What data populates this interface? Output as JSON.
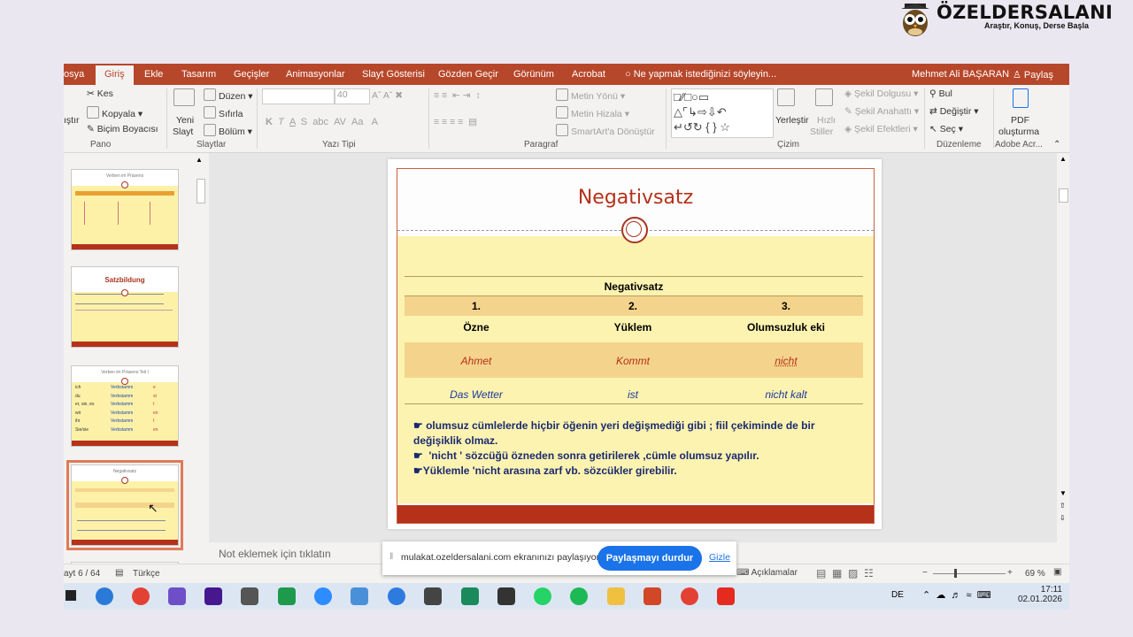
{
  "brand": {
    "name": "ÖZELDERSALANI",
    "tagline": "Araştır, Konuş, Derse Başla"
  },
  "tabs": {
    "dosya": "osya",
    "giris": "Giriş",
    "ekle": "Ekle",
    "tasarim": "Tasarım",
    "gecisler": "Geçişler",
    "animasyonlar": "Animasyonlar",
    "slayt": "Slayt Gösterisi",
    "gozden": "Gözden Geçir",
    "gorunum": "Görünüm",
    "acrobat": "Acrobat",
    "tell": "Ne yapmak istediğinizi söyleyin...",
    "user": "Mehmet Ali BAŞARAN",
    "share": "Paylaş"
  },
  "ribbon": {
    "paste": "ıştır",
    "kes": "Kes",
    "kopyala": "Kopyala",
    "bicim": "Biçim Boyacısı",
    "pano": "Pano",
    "yeni1": "Yeni",
    "yeni2": "Slayt",
    "duzen": "Düzen",
    "sifirla": "Sıfırla",
    "bolum": "Bölüm",
    "slaytlar": "Slaytlar",
    "font_size": "40",
    "yazi_tipi": "Yazı Tipi",
    "metin_yonu": "Metin Yönü",
    "metin_hizala": "Metin Hizala",
    "smartart": "SmartArt'a Dönüştür",
    "paragraf": "Paragraf",
    "yerlestir": "Yerleştir",
    "hizli1": "Hızlı",
    "hizli2": "Stiller",
    "sekil_dolgusu": "Şekil Dolgusu",
    "sekil_anahatti": "Şekil Anahattı",
    "sekil_efektleri": "Şekil Efektleri",
    "cizim": "Çizim",
    "bul": "Bul",
    "degistir": "Değiştir",
    "sec": "Seç",
    "duzenleme": "Düzenleme",
    "pdf1": "PDF",
    "pdf2": "oluşturma",
    "adobe": "Adobe Acr..."
  },
  "thumbnails": {
    "t1": "Verben im Präsens",
    "t2": "Satzbildung",
    "t3": "Verben im Präsens Teil I",
    "t3_rows": [
      {
        "p": "ich",
        "v": "Verbstamm",
        "e": "e"
      },
      {
        "p": "du",
        "v": "Verbstamm",
        "e": "st"
      },
      {
        "p": "er, sie, es",
        "v": "Verbstamm",
        "e": "t"
      },
      {
        "p": "wir",
        "v": "Verbstamm",
        "e": "en"
      },
      {
        "p": "ihr",
        "v": "Verbstamm",
        "e": "t"
      },
      {
        "p": "Sie/sie",
        "v": "Verbstamm",
        "e": "en"
      }
    ],
    "t4": "Negativsatz"
  },
  "slide": {
    "title": "Negativsatz",
    "table_title": "Negativsatz",
    "num1": "1.",
    "num2": "2.",
    "num3": "3.",
    "h1": "Özne",
    "h2": "Yüklem",
    "h3": "Olumsuzluk eki",
    "r1c1": "Ahmet",
    "r1c2": "Kommt",
    "r1c3": "nicht",
    "r2c1": "Das Wetter",
    "r2c2": "ist",
    "r2c3": "nicht kalt",
    "b1": "olumsuz cümlelerde hiçbir öğenin yeri değişmediği gibi ; fiil çekiminde de bir değişiklik olmaz.",
    "b2": "'nicht ' sözcüğü  özneden sonra getirilerek ,cümle olumsuz yapılır.",
    "b3": "Yüklemle 'nicht arasına zarf vb. sözcükler girebilir."
  },
  "notes": "Not eklemek için tıklatın",
  "status": {
    "slide": "ayt 6 / 64",
    "lang": "Türkçe",
    "comments": "Açıklamalar",
    "zoom": "69 %"
  },
  "share_bar": {
    "text": "mulakat.ozeldersalani.com ekranınızı paylaşıyor.",
    "stop": "Paylaşmayı durdur",
    "hide": "Gizle"
  },
  "tray": {
    "lang": "DE",
    "time": "17:11",
    "date": "02.01.2026"
  },
  "colors": {
    "ribbon": "#b7472a",
    "slide_title": "#b5311a",
    "slide_yellow": "#fdf3b0"
  }
}
